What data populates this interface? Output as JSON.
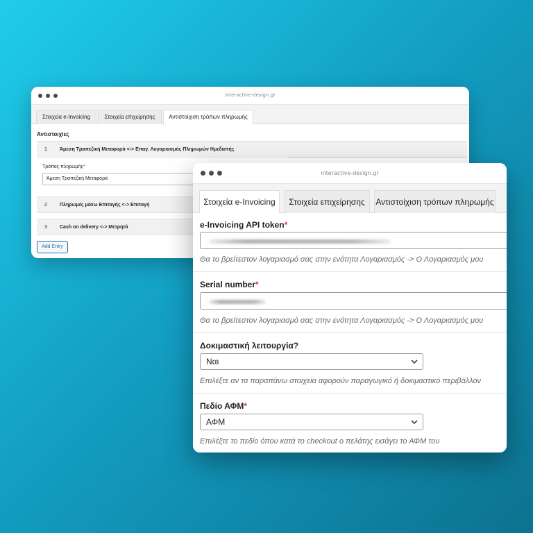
{
  "back_window": {
    "url": "interactive-design.gr",
    "tabs": [
      "Στοιχεία e-Invoicing",
      "Στοιχεία επιχείρησης",
      "Αντιστοίχιση τρόπων πληρωμής"
    ],
    "section_title": "Αντιστοιχίες",
    "entries": [
      {
        "num": "1",
        "label": "Άμεση Τραπεζική Μεταφορά <-> Επαγ. Λογαριασμός Πληρωμών Ημεδαπής"
      },
      {
        "num": "2",
        "label": "Πληρωμές μέσω Επιταγής <-> Επιταγή"
      },
      {
        "num": "3",
        "label": "Cash on delivery <-> Μετρητά"
      }
    ],
    "field_label": "Τρόπος πληρωμής",
    "required_mark": "*",
    "field_value": "Άμεση Τραπεζική Μεταφορά",
    "add_button": "Add Entry"
  },
  "front_window": {
    "url": "interactive-design.gr",
    "tabs": [
      "Στοιχεία e-Invoicing",
      "Στοιχεία επιχείρησης",
      "Αντιστοίχιση τρόπων πληρωμής"
    ],
    "active_tab": 0,
    "fields": {
      "api_token": {
        "label": "e-Invoicing API token",
        "required_mark": "*",
        "help": "Θα το βρείτεστον λογαριασμό σας στην ενότητα Λογαριασμός -> Ο Λογαριασμός μου"
      },
      "serial": {
        "label": "Serial number",
        "required_mark": "*",
        "help": "Θα το βρείτεστον λογαριασμό σας στην ενότητα Λογαριασμός -> Ο Λογαριασμός μου"
      },
      "test_mode": {
        "label": "Δοκιμαστική λειτουργία?",
        "value": "Ναι",
        "help": "Επιλέξτε αν τα παραπάνω στοιχεία αφορούν παραγωγικό ή δοκιμαστικό περιβάλλον"
      },
      "vat_field": {
        "label": "Πεδίο ΑΦΜ",
        "required_mark": "*",
        "value": "ΑΦΜ",
        "help": "Επιλέξτε το πεδίο όπου κατά το checkout ο πελάτης εισάγει το ΑΦΜ του"
      }
    }
  }
}
